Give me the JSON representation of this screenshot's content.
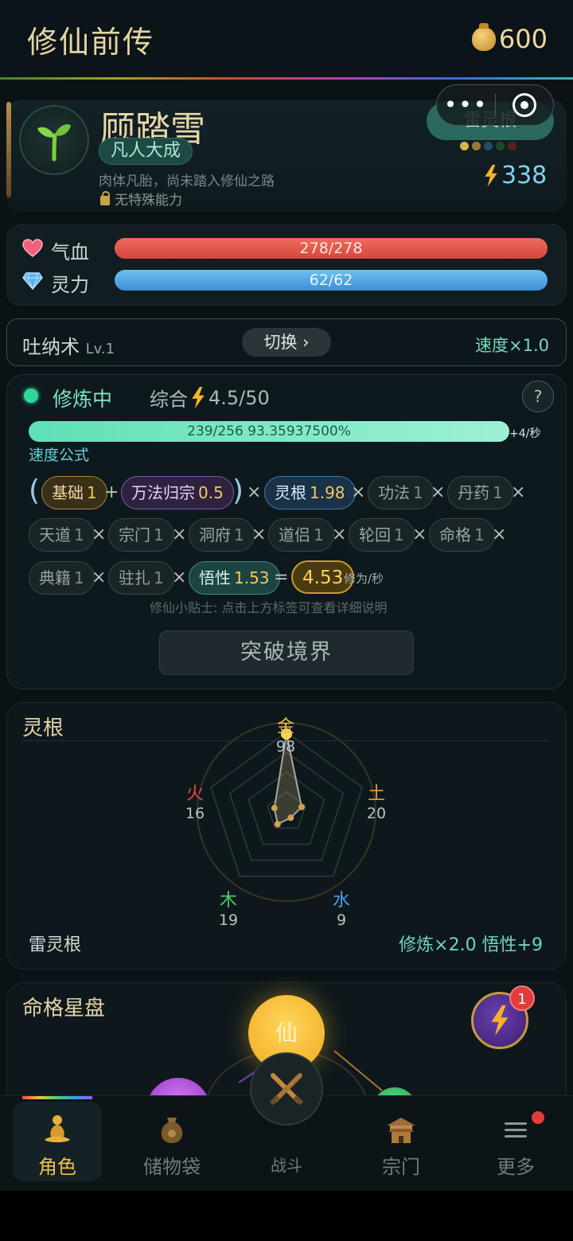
{
  "app": {
    "title": "修仙前传",
    "coins": "600"
  },
  "character": {
    "name": "顾踏雪",
    "realm": "凡人大成",
    "description": "肉体凡胎，尚未踏入修仙之路",
    "ability": "无特殊能力",
    "spirit_root": "雷灵根",
    "energy": "338"
  },
  "stats": {
    "hp": {
      "label": "气血",
      "value": "278/278",
      "fraction": 1.0
    },
    "mp": {
      "label": "灵力",
      "value": "62/62",
      "fraction": 1.0
    }
  },
  "technique": {
    "name": "吐纳术",
    "level": "Lv.1",
    "switch_label": "切换 ›",
    "speed": "速度×1.0"
  },
  "cultivation": {
    "status": "修炼中",
    "score_label": "综合",
    "score": "4.5/50",
    "help": "?",
    "progress_text": "239/256  93.35937500%",
    "progress_fraction": 0.9336,
    "rate": "+4/秒",
    "formula_label": "速度公式",
    "formula": {
      "base": {
        "label": "基础",
        "value": "1"
      },
      "wanfa": {
        "label": "万法归宗",
        "value": "0.5"
      },
      "linggen": {
        "label": "灵根",
        "value": "1.98"
      },
      "gongfa": {
        "label": "功法",
        "value": "1"
      },
      "danyao": {
        "label": "丹药",
        "value": "1"
      },
      "tiandao": {
        "label": "天道",
        "value": "1"
      },
      "zongmen": {
        "label": "宗门",
        "value": "1"
      },
      "dongfu": {
        "label": "洞府",
        "value": "1"
      },
      "daolv": {
        "label": "道侣",
        "value": "1"
      },
      "lunhui": {
        "label": "轮回",
        "value": "1"
      },
      "mingge": {
        "label": "命格",
        "value": "1"
      },
      "dianji": {
        "label": "典籍",
        "value": "1"
      },
      "zhuzha": {
        "label": "驻扎",
        "value": "1"
      },
      "wuxing": {
        "label": "悟性",
        "value": "1.53"
      },
      "result": "4.53",
      "unit": "修为/秒",
      "symbols": {
        "open": "(",
        "close": ")",
        "plus": "+",
        "times": "×",
        "equals": "="
      }
    },
    "tip": "修仙小贴士: 点击上方标签可查看详细说明",
    "breakthrough_label": "突破境界"
  },
  "spirit_root_panel": {
    "title": "灵根",
    "elements": [
      {
        "name": "金",
        "value": 98,
        "color": "#f0c04a"
      },
      {
        "name": "土",
        "value": 20,
        "color": "#e0a040"
      },
      {
        "name": "水",
        "value": 9,
        "color": "#4a9cf0"
      },
      {
        "name": "木",
        "value": 19,
        "color": "#4ad06a"
      },
      {
        "name": "火",
        "value": 16,
        "color": "#e04a3a"
      }
    ],
    "root_name": "雷灵根",
    "bonus": "修炼×2.0  悟性+9"
  },
  "fate": {
    "title": "命格星盘",
    "center_label": "仙",
    "badge": "1"
  },
  "nav": {
    "items": [
      {
        "label": "角色",
        "active": true
      },
      {
        "label": "储物袋"
      },
      {
        "label": "战斗"
      },
      {
        "label": "宗门"
      },
      {
        "label": "更多"
      }
    ]
  },
  "colors": {
    "accent_gold": "#f0c04a",
    "accent_teal": "#72d4bb",
    "hp": "#e5574b",
    "mp": "#4da4e4"
  }
}
